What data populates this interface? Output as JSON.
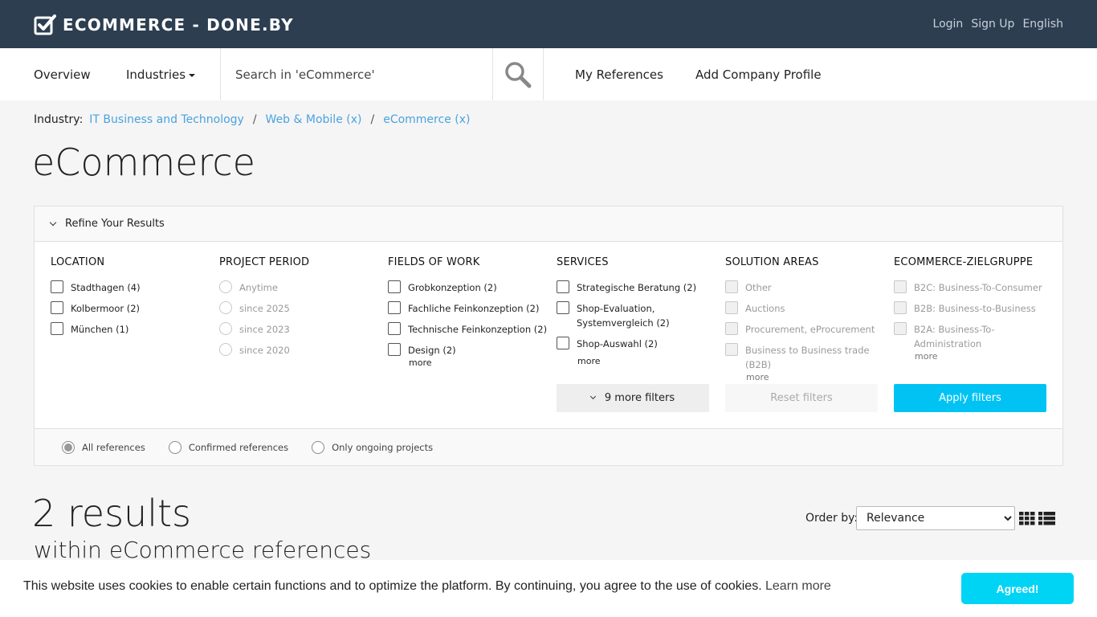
{
  "header": {
    "brand": "ECOMMERCE - DONE.BY",
    "links": [
      "Login",
      "Sign Up",
      "English"
    ]
  },
  "nav": {
    "overview": "Overview",
    "industries": "Industries",
    "search_placeholder": "Search in 'eCommerce'",
    "my_references": "My References",
    "add_company_profile": "Add Company Profile"
  },
  "breadcrumb": {
    "label": "Industry:",
    "items": [
      "IT Business and Technology",
      "Web & Mobile (x)",
      "eCommerce (x)"
    ],
    "separator": "/"
  },
  "page_title": "eCommerce",
  "filters": {
    "toggle_label": "Refine Your Results",
    "columns": [
      {
        "title": "LOCATION",
        "options": [
          "Stadthagen (4)",
          "Kolbermoor (2)",
          "München (1)"
        ]
      },
      {
        "title": "PROJECT PERIOD",
        "options": [
          "Anytime",
          "since 2025",
          "since 2023",
          "since 2020"
        ]
      },
      {
        "title": "FIELDS OF WORK",
        "options": [
          "Grobkonzeption (2)",
          "Fachliche Feinkonzeption (2)",
          "Technische Feinkonzeption (2)",
          "Design (2)"
        ],
        "more": "more"
      },
      {
        "title": "SERVICES",
        "options": [
          "Strategische Beratung (2)",
          "Shop-Evaluation, Systemvergleich (2)",
          "Shop-Auswahl (2)"
        ],
        "more": "more"
      },
      {
        "title": "SOLUTION AREAS",
        "options": [
          "Other",
          "Auctions",
          "Procurement, eProcurement",
          "Business to Business trade (B2B)"
        ],
        "more": "more"
      },
      {
        "title": "ECOMMERCE-ZIELGRUPPE",
        "options": [
          "B2C: Business-To-Consumer",
          "B2B: Business-to-Business",
          "B2A: Business-To-Administration"
        ],
        "more": "more"
      }
    ],
    "more_filters": "9 more filters",
    "reset": "Reset filters",
    "apply": "Apply filters",
    "reference_types": [
      "All references",
      "Confirmed references",
      "Only ongoing projects"
    ],
    "selected_reference_type": "All references"
  },
  "results": {
    "count_text": "2 results",
    "subtitle": "within eCommerce references",
    "order_label": "Order by:",
    "order_value": "Relevance"
  },
  "cookie": {
    "text": "This website uses cookies to enable certain functions and to optimize the platform. By continuing, you agree to the use of cookies.",
    "learn_more": "Learn more",
    "button": "Agreed!"
  },
  "colors": {
    "header_bg": "#2c3e50",
    "link": "#4aa3df",
    "accent": "#00c3f4"
  }
}
